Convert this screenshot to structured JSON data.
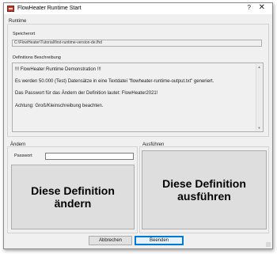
{
  "window": {
    "title": "FlowHeater Runtime Start",
    "help_label": "?",
    "close_label": "✕"
  },
  "runtime": {
    "group_label": "Runtime",
    "storage_label": "Speicherort",
    "path_value": "C:\\FlowHeater\\Tutorial\\first-runtime-version-de.fhd",
    "description_label": "Definitions Beschreibung",
    "description_lines": [
      "!!! FlowHeater Runtime Demonstration !!!",
      "Es werden 50.000 (Test) Datensätze in eine Textdatei \"flowheater-runtime-output.txt\" generiert.",
      "Das Passwort für das Ändern der Definition lautet: FlowHeater2021!",
      "Achtung: Groß/Kleinschreibung beachten."
    ]
  },
  "change": {
    "group_label": "Ändern",
    "password_label": "Passwort",
    "password_value": "",
    "button_line1": "Diese Definition",
    "button_line2": "ändern"
  },
  "execute": {
    "group_label": "Ausführen",
    "button_line1": "Diese Definition",
    "button_line2": "ausführen"
  },
  "footer": {
    "cancel_label": "Abbrechen",
    "quit_label": "Beenden"
  }
}
